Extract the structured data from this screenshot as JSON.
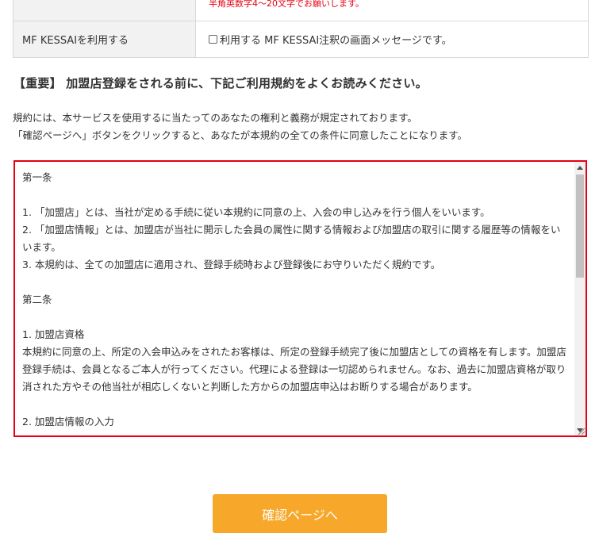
{
  "form": {
    "rows": [
      {
        "label": "",
        "hint": "半角英数字4～20文字でお願いします。"
      },
      {
        "label": "MF KESSAIを利用する",
        "checkbox_label": "利用する MF KESSAI注釈の画面メッセージです。",
        "checked": false
      }
    ]
  },
  "notice": {
    "headline": "【重要】 加盟店登録をされる前に、下記ご利用規約をよくお読みください。",
    "intro_lines": [
      "規約には、本サービスを使用するに当たってのあなたの権利と義務が規定されております。",
      "「確認ページへ」ボタンをクリックすると、あなたが本規約の全ての条件に同意したことになります。"
    ]
  },
  "terms": {
    "lines": [
      "第一条",
      "",
      "1. 「加盟店」とは、当社が定める手続に従い本規約に同意の上、入会の申し込みを行う個人をいいます。",
      "2. 「加盟店情報」とは、加盟店が当社に開示した会員の属性に関する情報および加盟店の取引に関する履歴等の情報をいいます。",
      "3. 本規約は、全ての加盟店に適用され、登録手続時および登録後にお守りいただく規約です。",
      "",
      "第二条",
      "",
      "1. 加盟店資格",
      "本規約に同意の上、所定の入会申込みをされたお客様は、所定の登録手続完了後に加盟店としての資格を有します。加盟店登録手続は、会員となるご本人が行ってください。代理による登録は一切認められません。なお、過去に加盟店資格が取り消された方やその他当社が相応しくないと判断した方からの加盟店申込はお断りする場合があります。",
      "",
      "2. 加盟店情報の入力"
    ]
  },
  "confirm_button": {
    "label": "確認ページへ"
  },
  "colors": {
    "accent": "#f7a72a",
    "alert": "#e60012"
  }
}
